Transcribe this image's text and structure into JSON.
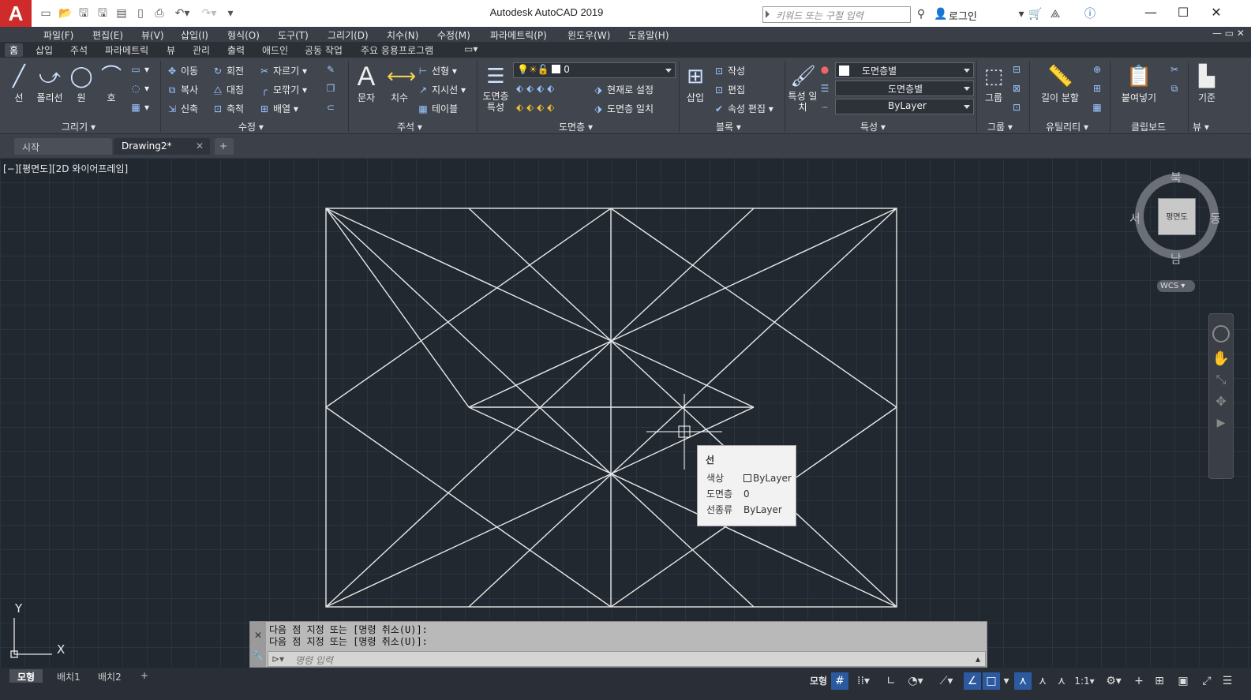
{
  "title_bar": {
    "app_title": "Autodesk AutoCAD 2019",
    "logo_letter": "A",
    "search_placeholder": "키워드 또는 구절 입력",
    "login_label": "로그인"
  },
  "menu": [
    "파일(F)",
    "편집(E)",
    "뷰(V)",
    "삽입(I)",
    "형식(O)",
    "도구(T)",
    "그리기(D)",
    "치수(N)",
    "수정(M)",
    "파라메트릭(P)",
    "윈도우(W)",
    "도움말(H)"
  ],
  "ribbon_tabs": [
    "홈",
    "삽입",
    "주석",
    "파라메트릭",
    "뷰",
    "관리",
    "출력",
    "애드인",
    "공동 작업",
    "주요 응용프로그램"
  ],
  "ribbon": {
    "draw": {
      "label": "그리기",
      "line": "선",
      "polyline": "폴리선",
      "circle": "원",
      "arc": "호"
    },
    "modify": {
      "label": "수정",
      "move": "이동",
      "rotate": "회전",
      "trim": "자르기",
      "copy": "복사",
      "mirror": "대칭",
      "fillet": "모깎기",
      "stretch": "신축",
      "scale": "축척",
      "array": "배열"
    },
    "annotation": {
      "label": "주석",
      "text": "문자",
      "dimension": "치수",
      "linear": "선형",
      "leader": "지시선",
      "table": "테이블"
    },
    "layers": {
      "label": "도면층",
      "properties": "도면층 특성",
      "current_layer": "0",
      "set_current": "현재로 설정",
      "match_layer": "도면층 일치"
    },
    "block": {
      "label": "블록",
      "insert": "삽입",
      "create": "작성",
      "edit": "편집",
      "edit_attr": "속성 편집"
    },
    "properties": {
      "label": "특성",
      "match": "특성 일치",
      "color": "도면층별",
      "linetype": "도면층별",
      "lineweight": "ByLayer"
    },
    "groups": {
      "label": "그룹",
      "group": "그룹"
    },
    "utilities": {
      "label": "유틸리티",
      "measure": "길이 분할"
    },
    "clipboard": {
      "label": "클립보드",
      "paste": "붙여넣기"
    },
    "view": {
      "label": "뷰",
      "base": "기준"
    }
  },
  "doc_tabs": [
    "시작",
    "Drawing2*"
  ],
  "viewport": {
    "label": "[−][평면도][2D 와이어프레임]",
    "viewcube": {
      "north": "북",
      "south": "남",
      "east": "동",
      "west": "서",
      "face": "평면도",
      "wcs": "WCS"
    },
    "ucs": {
      "y": "Y",
      "x": "X"
    }
  },
  "tooltip": {
    "title": "선",
    "rows": [
      {
        "key": "색상",
        "value": "ByLayer"
      },
      {
        "key": "도면층",
        "value": "0"
      },
      {
        "key": "선종류",
        "value": "ByLayer"
      }
    ]
  },
  "command": {
    "history": [
      "다음 점 지정 또는 [명령 취소(U)]:",
      "다음 점 지정 또는 [명령 취소(U)]:"
    ],
    "placeholder": "명령 입력"
  },
  "layout_tabs": [
    "모형",
    "배치1",
    "배치2"
  ],
  "status": {
    "model": "모형",
    "scale": "1:1"
  },
  "colors": {
    "accent": "#2c5aa0",
    "canvas": "#212830",
    "logo": "#cf2b2b"
  }
}
